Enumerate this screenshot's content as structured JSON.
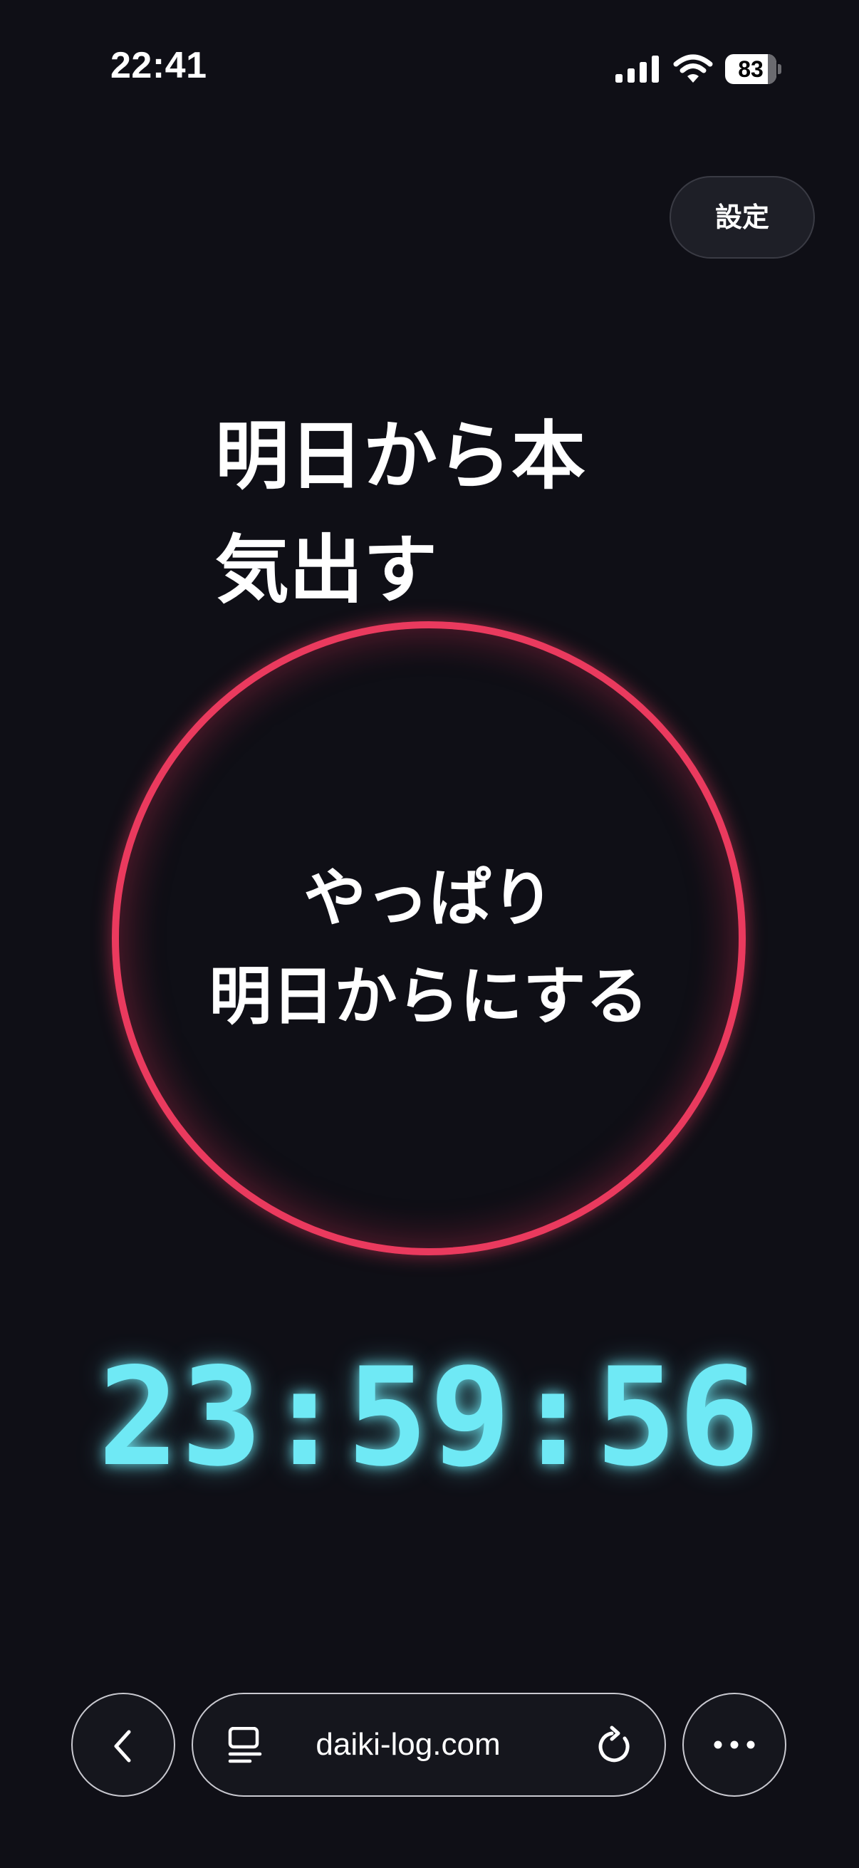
{
  "status_bar": {
    "time": "22:41",
    "battery_percent": 83,
    "battery_label": "83",
    "icons": [
      "cellular-signal-icon",
      "wifi-icon",
      "battery-icon"
    ]
  },
  "header": {
    "settings_label": "設定"
  },
  "headline": {
    "line1": "明日から本",
    "line2": "気出す"
  },
  "circle_button": {
    "line1": "やっぱり",
    "line2": "明日からにする",
    "ring_color": "#ea3a5e"
  },
  "countdown": {
    "value": "23:59:56",
    "color": "#6fe9f5"
  },
  "browser_bar": {
    "url": "daiki-log.com",
    "icons": [
      "back-chevron-icon",
      "reader-icon",
      "reload-icon",
      "more-icon"
    ]
  },
  "colors": {
    "background": "#0f0f16",
    "accent_red": "#ea3a5e",
    "accent_cyan": "#6fe9f5"
  }
}
